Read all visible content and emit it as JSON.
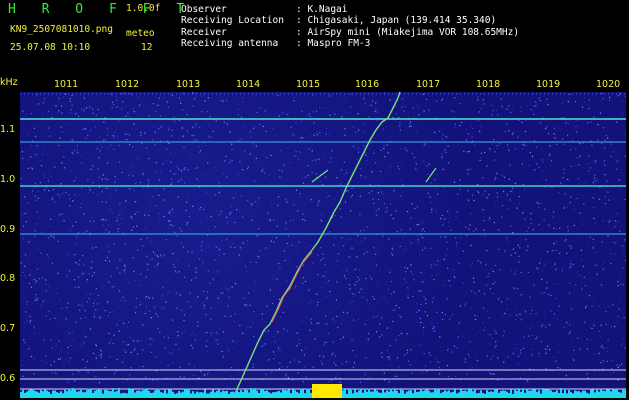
{
  "header": {
    "app_title": "H R O F F T",
    "version": "1.0.0f",
    "filename": "KN9_2507081010.png",
    "mode_label": "meteo",
    "datetime": "25.07.08 10:10",
    "count": "12",
    "info_labels": [
      "Observer",
      "Receiving Location",
      "Receiver",
      "Receiving antenna"
    ],
    "info_values": [
      ": K.Nagai",
      ": Chigasaki, Japan (139.414 35.340)",
      ": AirSpy mini (Miakejima VOR 108.65MHz)",
      ": Maspro FM-3"
    ]
  },
  "axis": {
    "unit_label": "kHz",
    "x_ticks": [
      "1011",
      "1012",
      "1013",
      "1014",
      "1015",
      "1016",
      "1017",
      "1018",
      "1019",
      "1020"
    ],
    "y_ticks": [
      "1.1",
      "1.0",
      "0.9",
      "0.8",
      "0.7",
      "0.6"
    ]
  },
  "colors": {
    "background": "#12127a",
    "trace": "#7de07a",
    "line": "#3cd6c8",
    "baseline": "#1fd8f0",
    "burst": "#ffe800",
    "text_yellow": "#f2f23a",
    "text_green": "#38e83a"
  }
}
